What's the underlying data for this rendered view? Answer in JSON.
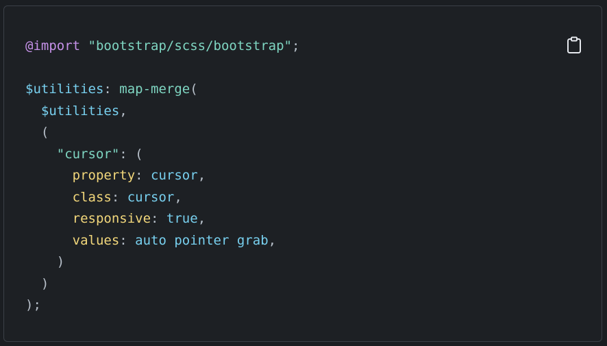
{
  "code_block": {
    "language": "scss",
    "copy_button_icon": "clipboard-icon",
    "lines": [
      [
        {
          "t": "at",
          "v": "@import"
        },
        {
          "t": "punc",
          "v": " "
        },
        {
          "t": "str",
          "v": "\"bootstrap/scss/bootstrap\""
        },
        {
          "t": "punc",
          "v": ";"
        }
      ],
      [],
      [
        {
          "t": "var",
          "v": "$utilities"
        },
        {
          "t": "punc",
          "v": ": "
        },
        {
          "t": "fn",
          "v": "map-merge"
        },
        {
          "t": "punc",
          "v": "("
        }
      ],
      [
        {
          "t": "punc",
          "v": "  "
        },
        {
          "t": "var",
          "v": "$utilities"
        },
        {
          "t": "punc",
          "v": ","
        }
      ],
      [
        {
          "t": "punc",
          "v": "  ("
        }
      ],
      [
        {
          "t": "punc",
          "v": "    "
        },
        {
          "t": "str",
          "v": "\"cursor\""
        },
        {
          "t": "punc",
          "v": ": ("
        }
      ],
      [
        {
          "t": "punc",
          "v": "      "
        },
        {
          "t": "prop",
          "v": "property"
        },
        {
          "t": "punc",
          "v": ": "
        },
        {
          "t": "val",
          "v": "cursor"
        },
        {
          "t": "punc",
          "v": ","
        }
      ],
      [
        {
          "t": "punc",
          "v": "      "
        },
        {
          "t": "prop",
          "v": "class"
        },
        {
          "t": "punc",
          "v": ": "
        },
        {
          "t": "val",
          "v": "cursor"
        },
        {
          "t": "punc",
          "v": ","
        }
      ],
      [
        {
          "t": "punc",
          "v": "      "
        },
        {
          "t": "prop",
          "v": "responsive"
        },
        {
          "t": "punc",
          "v": ": "
        },
        {
          "t": "val",
          "v": "true"
        },
        {
          "t": "punc",
          "v": ","
        }
      ],
      [
        {
          "t": "punc",
          "v": "      "
        },
        {
          "t": "prop",
          "v": "values"
        },
        {
          "t": "punc",
          "v": ": "
        },
        {
          "t": "val",
          "v": "auto pointer grab"
        },
        {
          "t": "punc",
          "v": ","
        }
      ],
      [
        {
          "t": "punc",
          "v": "    )"
        }
      ],
      [
        {
          "t": "punc",
          "v": "  )"
        }
      ],
      [
        {
          "t": "punc",
          "v": ");"
        }
      ]
    ]
  },
  "colors": {
    "background": "#1d2024",
    "border": "#3b4047",
    "at_rule": "#c792ea",
    "string": "#7fd6c2",
    "variable": "#78d0ef",
    "property": "#f2d77b",
    "punctuation": "#b8c0ca"
  }
}
